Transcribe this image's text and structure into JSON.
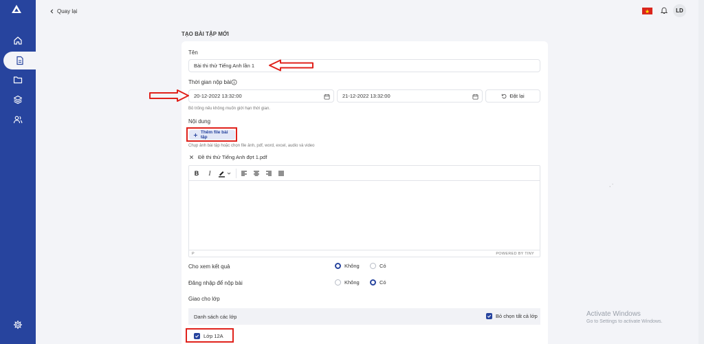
{
  "topbar": {
    "back_label": "Quay lại",
    "avatar_initials": "LD"
  },
  "page": {
    "title": "TẠO BÀI TẬP MỚI"
  },
  "form": {
    "name_label": "Tên",
    "name_value": "Bài thi thử Tiếng Anh lần 1",
    "deadline_label": "Thời gian nộp bài",
    "start_value": "20-12-2022 13:32:00",
    "end_value": "21-12-2022 13:32:00",
    "reset_label": "Đặt lại",
    "deadline_hint": "Bỏ trống nếu không muốn giới hạn thời gian.",
    "content_label": "Nội dung",
    "add_file_label": "Thêm file bài tập",
    "add_file_hint": "Chụp ảnh bài tập hoặc chọn file ảnh, pdf, word, excel, audio và video",
    "file_name": "Đề thi thử Tiếng Anh đợt 1.pdf",
    "editor_status_p": "P",
    "editor_powered": "POWERED BY TINY",
    "show_result_label": "Cho xem kết quả",
    "login_submit_label": "Đăng nhập để nộp bài",
    "option_no": "Không",
    "option_yes": "Có",
    "assign_label": "Giao cho lớp",
    "class_list_label": "Danh sách các lớp",
    "deselect_all_label": "Bỏ chọn tất cả lớp",
    "class_item": "Lớp 12A"
  },
  "toolbar_glyphs": {
    "bold": "B",
    "italic": "I"
  },
  "watermark": {
    "title": "Activate Windows",
    "subtitle": "Go to Settings to activate Windows."
  },
  "colors": {
    "brand": "#27449e",
    "annotation": "#e0211b"
  },
  "icons": [
    "logo-icon",
    "home-icon",
    "document-icon",
    "folder-icon",
    "layers-icon",
    "users-icon",
    "settings-icon",
    "flag-icon",
    "bell-icon",
    "calendar-icon",
    "info-icon",
    "reset-icon",
    "plus-icon",
    "close-icon",
    "bold-icon",
    "italic-icon",
    "highlight-icon",
    "align-left-icon",
    "align-center-icon",
    "align-right-icon",
    "align-justify-icon",
    "check-icon"
  ]
}
